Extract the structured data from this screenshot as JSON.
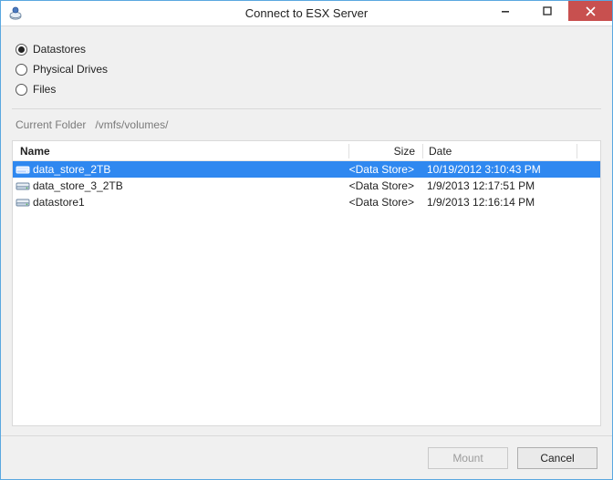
{
  "window": {
    "title": "Connect to ESX Server"
  },
  "radios": {
    "datastores": "Datastores",
    "physical": "Physical Drives",
    "files": "Files"
  },
  "path": {
    "label": "Current Folder",
    "value": "/vmfs/volumes/"
  },
  "columns": {
    "name": "Name",
    "size": "Size",
    "date": "Date"
  },
  "rows": [
    {
      "name": "data_store_2TB",
      "size": "<Data Store>",
      "date": "10/19/2012 3:10:43 PM",
      "selected": true
    },
    {
      "name": "data_store_3_2TB",
      "size": "<Data Store>",
      "date": "1/9/2013 12:17:51 PM",
      "selected": false
    },
    {
      "name": "datastore1",
      "size": "<Data Store>",
      "date": "1/9/2013 12:16:14 PM",
      "selected": false
    }
  ],
  "buttons": {
    "mount": "Mount",
    "cancel": "Cancel"
  }
}
